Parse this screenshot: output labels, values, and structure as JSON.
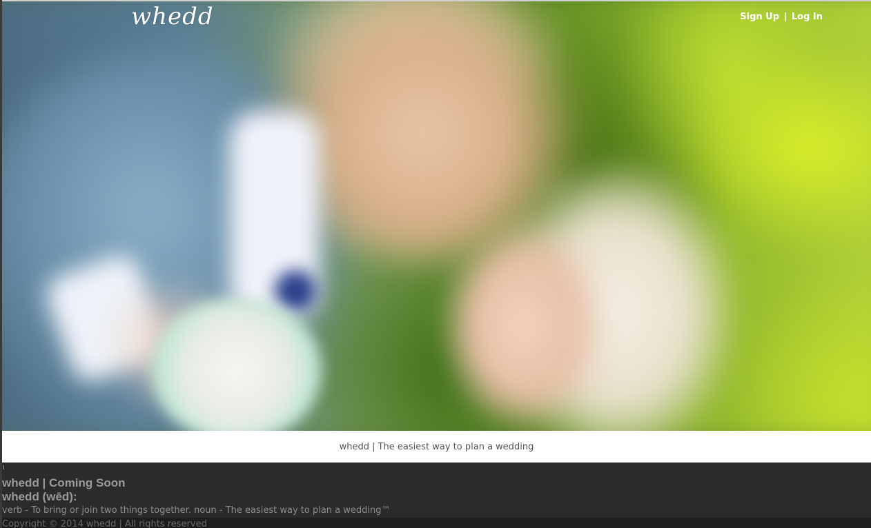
{
  "header": {
    "logo_text": "whedd",
    "sign_up_label": "Sign Up",
    "separator": "|",
    "log_in_label": "Log In"
  },
  "hero": {
    "image": "blurred-couple-photo"
  },
  "tagline": {
    "text": "whedd | The easiest way to plan a wedding"
  },
  "info": {
    "title": "whedd | Coming Soon",
    "definition_heading": "whedd (wēd):",
    "definition_text": "verb - To bring or join two things together. noun - The easiest way to plan a wedding™"
  },
  "footer": {
    "copyright": "Copyright © 2014 whedd | All rights reserved"
  },
  "colors": {
    "footer_bg": "#2b2b2b",
    "tagline_bg": "#ffffff",
    "header_text": "#ffffff"
  }
}
